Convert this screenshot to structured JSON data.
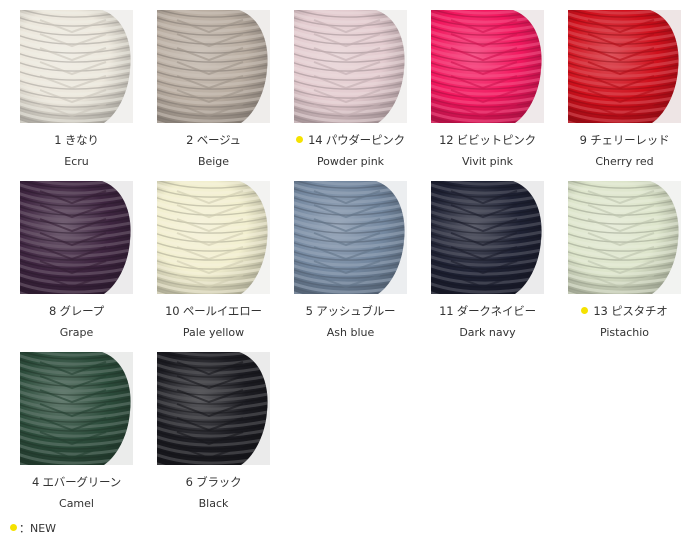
{
  "new_dot_color": "#f5e200",
  "colors": [
    {
      "jp": "1 きなり",
      "en": "Ecru",
      "yarn": "#ece7dc",
      "bg": "#f1f0ee",
      "new": false
    },
    {
      "jp": "2 ベージュ",
      "en": "Beige",
      "yarn": "#b9ada1",
      "bg": "#efedeb",
      "new": false
    },
    {
      "jp": "14 パウダーピンク",
      "en": "Powder pink",
      "yarn": "#e3cbcf",
      "bg": "#f2f1f0",
      "new": true
    },
    {
      "jp": "12 ビビットピンク",
      "en": "Vivit pink",
      "yarn": "#f2175e",
      "bg": "#efe9ea",
      "new": false
    },
    {
      "jp": "9 チェリーレッド",
      "en": "Cherry red",
      "yarn": "#d0101c",
      "bg": "#eee5e5",
      "new": false
    },
    {
      "jp": "8 グレープ",
      "en": "Grape",
      "yarn": "#3e2540",
      "bg": "#ecebec",
      "new": false
    },
    {
      "jp": "10 ペールイエロー",
      "en": "Pale yellow",
      "yarn": "#f2efcf",
      "bg": "#f3f3f1",
      "new": false
    },
    {
      "jp": "5 アッシュブルー",
      "en": "Ash blue",
      "yarn": "#7488a0",
      "bg": "#eceef0",
      "new": false
    },
    {
      "jp": "11 ダークネイビー",
      "en": "Dark navy",
      "yarn": "#1e2133",
      "bg": "#ebebec",
      "new": false
    },
    {
      "jp": "13 ピスタチオ",
      "en": "Pistachio",
      "yarn": "#dde5cb",
      "bg": "#f2f3f1",
      "new": true
    },
    {
      "jp": "4 エバーグリーン",
      "en": "Camel",
      "yarn": "#2c4c3b",
      "bg": "#ebeceb",
      "new": false
    },
    {
      "jp": "6 ブラック",
      "en": "Black",
      "yarn": "#1c1c22",
      "bg": "#ebebeb",
      "new": false
    }
  ],
  "legend": {
    "text": "：NEW"
  }
}
